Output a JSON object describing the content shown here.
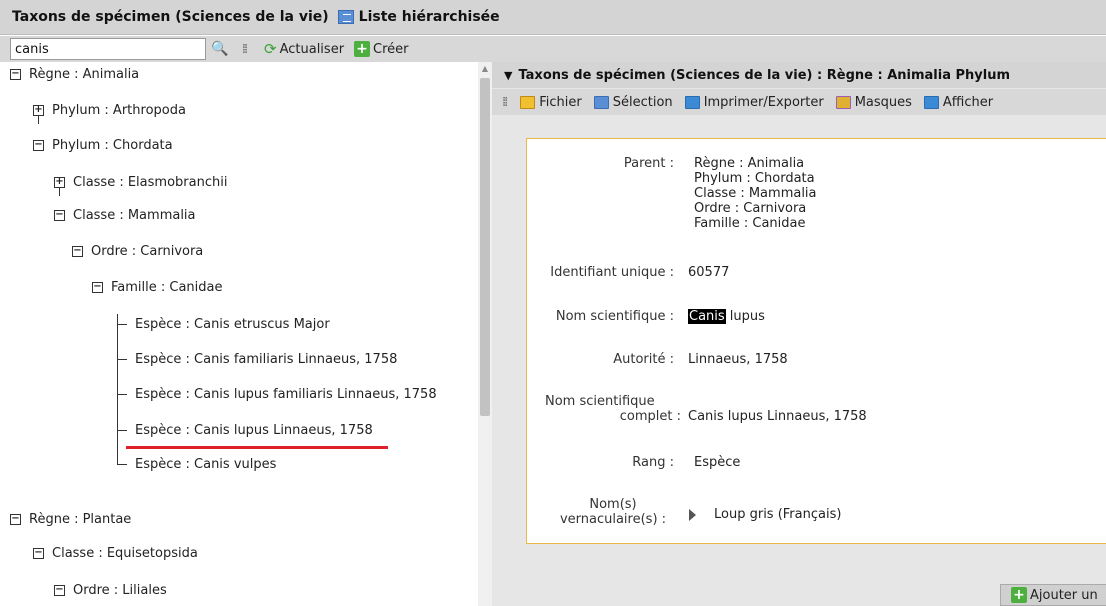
{
  "window": {
    "title": "Taxons de spécimen (Sciences de la vie)",
    "list_label": "Liste hiérarchisée"
  },
  "toolbar": {
    "search_value": "canis",
    "refresh_label": "Actualiser",
    "create_label": "Créer"
  },
  "tree": {
    "nodes": [
      {
        "label": "Règne : Animalia",
        "toggle": "⊟"
      },
      {
        "label": "Phylum : Arthropoda",
        "toggle": "+"
      },
      {
        "label": "Phylum : Chordata",
        "toggle": "−"
      },
      {
        "label": "Classe : Elasmobranchii",
        "toggle": "+"
      },
      {
        "label": "Classe : Mammalia",
        "toggle": "−"
      },
      {
        "label": "Ordre : Carnivora",
        "toggle": "−"
      },
      {
        "label": "Famille : Canidae",
        "toggle": "−"
      },
      {
        "label": "Espèce : Canis etruscus Major"
      },
      {
        "label": "Espèce : Canis familiaris Linnaeus, 1758"
      },
      {
        "label": "Espèce : Canis lupus familiaris Linnaeus, 1758"
      },
      {
        "label": "Espèce : Canis lupus Linnaeus, 1758"
      },
      {
        "label": "Espèce : Canis vulpes"
      },
      {
        "label": "Règne : Plantae",
        "toggle": "−"
      },
      {
        "label": "Classe : Equisetopsida",
        "toggle": "−"
      },
      {
        "label": "Ordre : Liliales",
        "toggle": "−"
      }
    ]
  },
  "detail": {
    "header": "Taxons de spécimen (Sciences de la vie) : Règne : Animalia Phylum",
    "toolbar": {
      "file": "Fichier",
      "selection": "Sélection",
      "print_export": "Imprimer/Exporter",
      "masks": "Masques",
      "show": "Afficher"
    },
    "labels": {
      "parent": "Parent :",
      "unique_id": "Identifiant unique :",
      "sci_name": "Nom scientifique :",
      "authority": "Autorité :",
      "full_name_1": "Nom scientifique",
      "full_name_2": "complet :",
      "rank": "Rang :",
      "vernacular_1": "Nom(s)",
      "vernacular_2": "vernaculaire(s) :"
    },
    "values": {
      "parent_lines": [
        "Règne : Animalia",
        "Phylum : Chordata",
        "Classe : Mammalia",
        "Ordre : Carnivora",
        "Famille : Canidae"
      ],
      "unique_id": "60577",
      "sci_name_highlight": "Canis",
      "sci_name_rest": " lupus",
      "authority": "Linnaeus, 1758",
      "full_name": "Canis lupus Linnaeus, 1758",
      "rank": "Espèce",
      "vernacular": "Loup gris (Français)"
    },
    "add_button": "Ajouter un"
  }
}
